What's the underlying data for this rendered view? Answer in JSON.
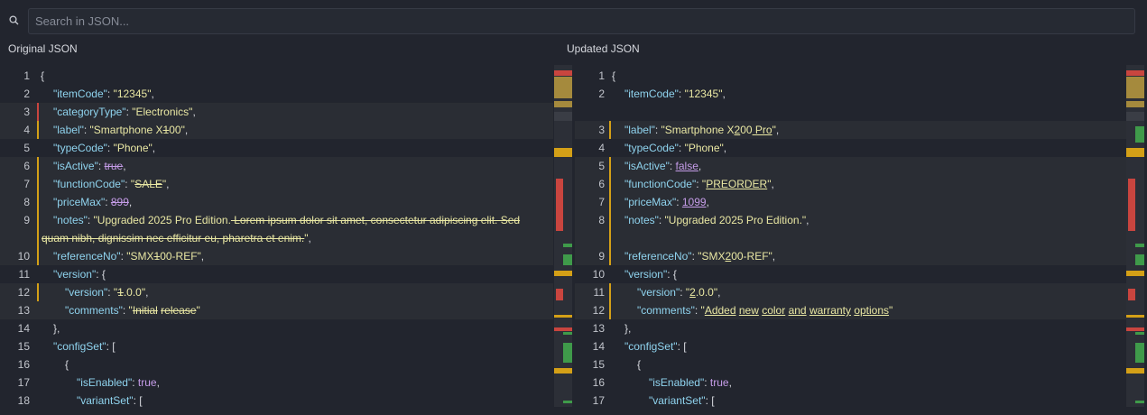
{
  "search": {
    "placeholder": "Search in JSON..."
  },
  "left": {
    "title": "Original JSON",
    "lines": [
      {
        "num": "1",
        "code": "{"
      },
      {
        "num": "2",
        "code": "\"itemCode\": \"12345\","
      },
      {
        "num": "3",
        "code": "\"categoryType\": \"Electronics\","
      },
      {
        "num": "4",
        "code": "\"label\": \"Smartphone X100\","
      },
      {
        "num": "5",
        "code": "\"typeCode\": \"Phone\","
      },
      {
        "num": "6",
        "code": "\"isActive\": true,"
      },
      {
        "num": "7",
        "code": "\"functionCode\": \"SALE\","
      },
      {
        "num": "8",
        "code": "\"priceMax\": 899,"
      },
      {
        "num": "9",
        "code": "\"notes\": \"Upgraded 2025 Pro Edition. Lorem ipsum dolor sit amet, consectetur adipiscing elit. Sed quam nibh, dignissim nec efficitur eu, pharetra et enim.\","
      },
      {
        "num": "10",
        "code": "\"referenceNo\": \"SMX100-REF\","
      },
      {
        "num": "11",
        "code": "\"version\": {"
      },
      {
        "num": "12",
        "code": "\"version\": \"1.0.0\","
      },
      {
        "num": "13",
        "code": "\"comments\": \"Initial release\""
      },
      {
        "num": "14",
        "code": "},"
      },
      {
        "num": "15",
        "code": "\"configSet\": ["
      },
      {
        "num": "16",
        "code": "{"
      },
      {
        "num": "17",
        "code": "\"isEnabled\": true,"
      },
      {
        "num": "18",
        "code": "\"variantSet\": ["
      }
    ]
  },
  "right": {
    "title": "Updated JSON",
    "lines": [
      {
        "num": "1",
        "code": "{"
      },
      {
        "num": "2",
        "code": "\"itemCode\": \"12345\","
      },
      {
        "num": "3",
        "code": "\"label\": \"Smartphone X200 Pro\","
      },
      {
        "num": "4",
        "code": "\"typeCode\": \"Phone\","
      },
      {
        "num": "5",
        "code": "\"isActive\": false,"
      },
      {
        "num": "6",
        "code": "\"functionCode\": \"PREORDER\","
      },
      {
        "num": "7",
        "code": "\"priceMax\": 1099,"
      },
      {
        "num": "8",
        "code": "\"notes\": \"Upgraded 2025 Pro Edition.\","
      },
      {
        "num": "9",
        "code": "\"referenceNo\": \"SMX200-REF\","
      },
      {
        "num": "10",
        "code": "\"version\": {"
      },
      {
        "num": "11",
        "code": "\"version\": \"2.0.0\","
      },
      {
        "num": "12",
        "code": "\"comments\": \"Added new color and warranty options\""
      },
      {
        "num": "13",
        "code": "},"
      },
      {
        "num": "14",
        "code": "\"configSet\": ["
      },
      {
        "num": "15",
        "code": "{"
      },
      {
        "num": "16",
        "code": "\"isEnabled\": true,"
      },
      {
        "num": "17",
        "code": "\"variantSet\": ["
      }
    ]
  },
  "colors": {
    "background": "#22252e",
    "key": "#8fd3ee",
    "string": "#e9e7a3",
    "literal": "#c59ce8",
    "removed": "#c9453f",
    "added": "#3f9a4a",
    "modified": "#d4a017"
  }
}
